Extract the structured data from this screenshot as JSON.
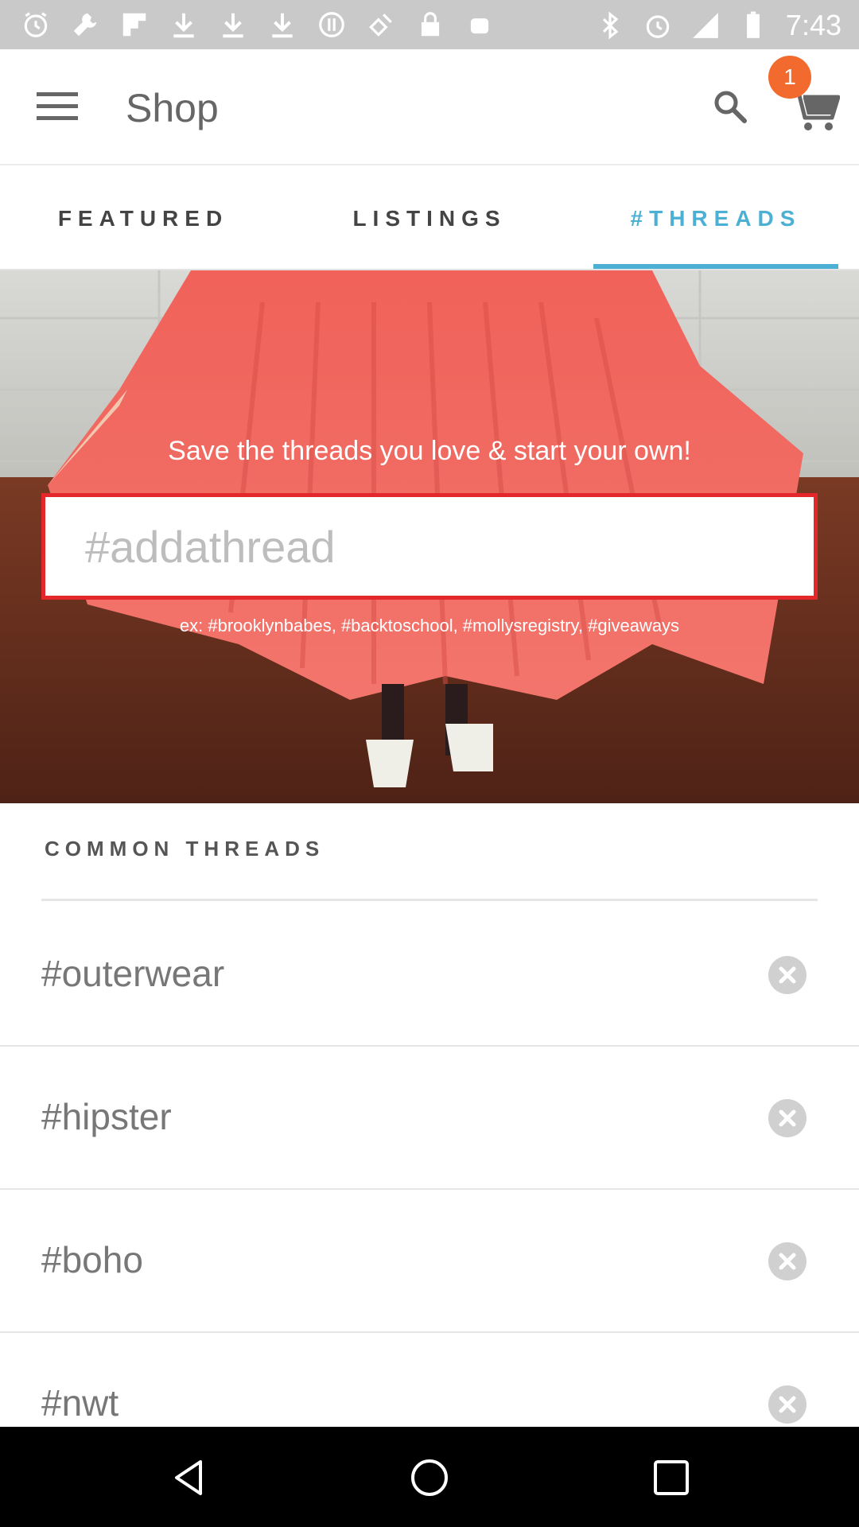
{
  "status_bar": {
    "time": "7:43",
    "left_icons": [
      "alarm-icon",
      "wrench-icon",
      "flipboard-icon",
      "download-icon",
      "download-icon",
      "download-icon",
      "blocked-icon",
      "satellite-icon",
      "lock-icon",
      "android-icon"
    ],
    "right_icons": [
      "bluetooth-icon",
      "alarm-icon",
      "signal-icon",
      "battery-icon"
    ]
  },
  "app_bar": {
    "title": "Shop",
    "cart_count": "1",
    "menu_icon": "menu-icon",
    "search_icon": "search-icon",
    "cart_icon": "cart-icon",
    "badge_color": "#f26a2e"
  },
  "tabs": [
    {
      "label": "FEATURED",
      "selected": false
    },
    {
      "label": "LISTINGS",
      "selected": false
    },
    {
      "label": "#THREADS",
      "selected": true
    }
  ],
  "accent_color": "#4bb0d4",
  "hero": {
    "caption": "Save the threads you love & start your own!",
    "input_placeholder": "#addathread",
    "input_value": "",
    "examples": "ex: #brooklynbabes, #backtoschool, #mollysregistry, #giveaways"
  },
  "common_threads": {
    "header": "COMMON THREADS",
    "items": [
      {
        "label": "#outerwear"
      },
      {
        "label": "#hipster"
      },
      {
        "label": "#boho"
      },
      {
        "label": "#nwt"
      }
    ]
  },
  "nav_bar": {
    "icons": [
      "back-icon",
      "home-icon",
      "recents-icon"
    ]
  }
}
